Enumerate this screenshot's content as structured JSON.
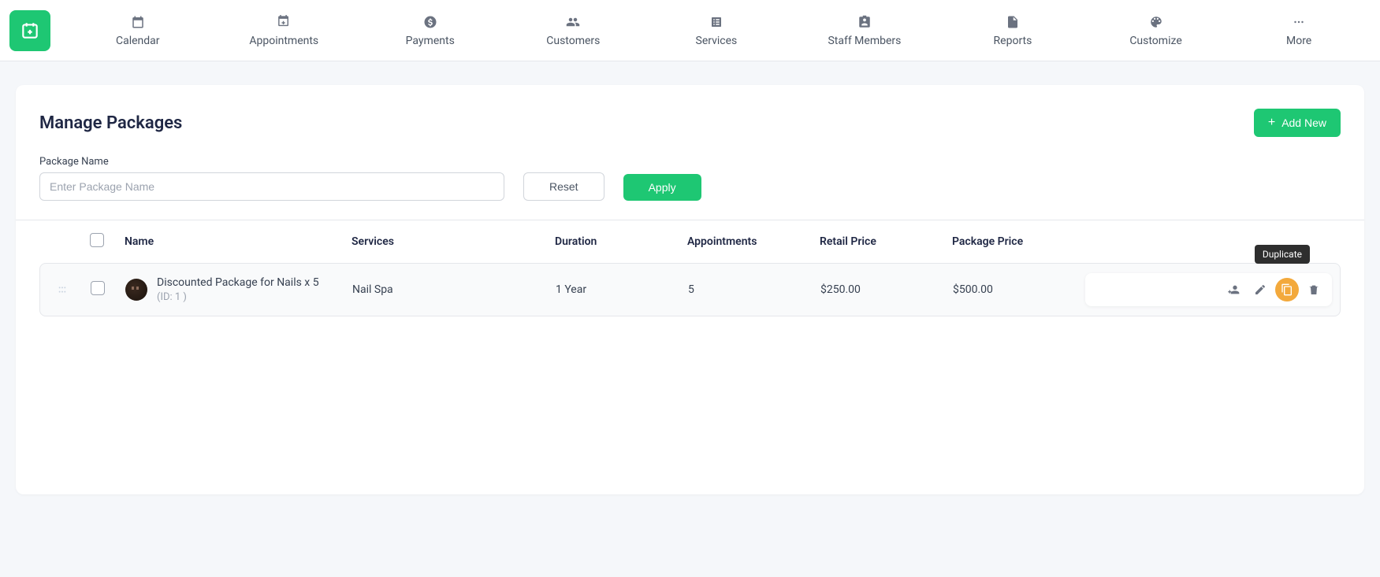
{
  "nav": {
    "items": [
      {
        "label": "Calendar"
      },
      {
        "label": "Appointments"
      },
      {
        "label": "Payments"
      },
      {
        "label": "Customers"
      },
      {
        "label": "Services"
      },
      {
        "label": "Staff Members"
      },
      {
        "label": "Reports"
      },
      {
        "label": "Customize"
      },
      {
        "label": "More"
      }
    ]
  },
  "page": {
    "title": "Manage Packages",
    "add_new_label": "Add New"
  },
  "filter": {
    "name_label": "Package Name",
    "name_placeholder": "Enter Package Name",
    "reset_label": "Reset",
    "apply_label": "Apply"
  },
  "table": {
    "headers": {
      "name": "Name",
      "services": "Services",
      "duration": "Duration",
      "appointments": "Appointments",
      "retail_price": "Retail Price",
      "package_price": "Package Price"
    },
    "rows": [
      {
        "name": "Discounted Package for Nails x 5",
        "id_text": "(ID: 1 )",
        "services": "Nail Spa",
        "duration": "1 Year",
        "appointments": "5",
        "retail_price": "$250.00",
        "package_price": "$500.00"
      }
    ]
  },
  "tooltip": {
    "duplicate": "Duplicate"
  }
}
